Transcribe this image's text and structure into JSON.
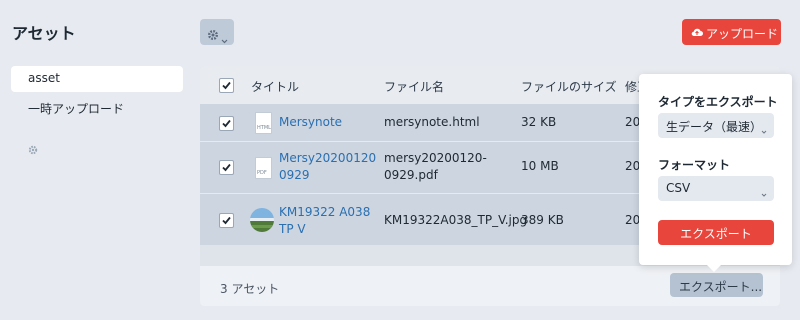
{
  "page": {
    "title": "アセット"
  },
  "sidebar": {
    "items": [
      {
        "label": "asset"
      },
      {
        "label": "一時アップロード"
      }
    ]
  },
  "toolbar": {
    "upload_label": "アップロード"
  },
  "table": {
    "headers": [
      "タイトル",
      "ファイル名",
      "ファイルのサイズ",
      "修正"
    ],
    "rows": [
      {
        "title": "Mersynote",
        "filename": "mersynote.html",
        "size": "32 KB",
        "modified": "20",
        "icon_label": "HTML"
      },
      {
        "title_line1": "Mersy20200120",
        "title_line2": "0929",
        "filename_line1": "mersy20200120-",
        "filename_line2": "0929.pdf",
        "size": "10 MB",
        "modified": "20",
        "icon_label": "PDF"
      },
      {
        "title_line1": "KM19322 A038",
        "title_line2": "TP V",
        "filename": "KM19322A038_TP_V.jpg",
        "size": "389 KB",
        "modified": "20"
      }
    ]
  },
  "footer": {
    "count": "3 アセット",
    "export_label": "エクスポート..."
  },
  "popover": {
    "type_label": "タイプをエクスポート",
    "type_value": "生データ（最速）",
    "format_label": "フォーマット",
    "format_value": "CSV",
    "export_button": "エクスポート"
  },
  "colors": {
    "accent": "#e8463c",
    "link": "#2a6fb0",
    "row_selected": "#ccd5e0"
  },
  "icons": [
    "gear-icon",
    "chevron-down-icon",
    "cloud-upload-icon",
    "checkbox-icon",
    "file-html-icon",
    "file-pdf-icon"
  ]
}
